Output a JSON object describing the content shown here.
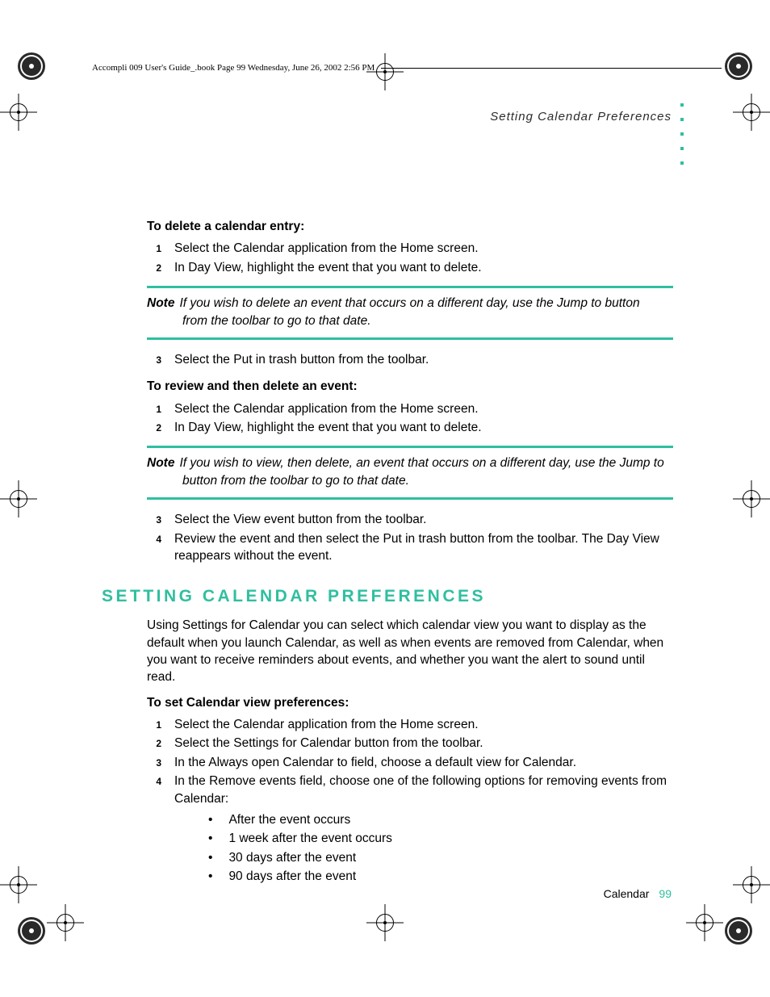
{
  "book_header": "Accompli 009 User's Guide_.book  Page 99  Wednesday, June 26, 2002  2:56 PM",
  "running_head": "Setting Calendar Preferences",
  "sections": {
    "delete": {
      "heading": "To delete a calendar entry:",
      "step1": "Select the Calendar application from the Home screen.",
      "step2": "In Day View, highlight the event that you want to delete.",
      "note_label": "Note",
      "note_text_1": "If you wish to delete an event that occurs on a different day, use the Jump to button",
      "note_text_2": "from the toolbar to go to that date.",
      "step3": "Select the Put in trash button from the toolbar."
    },
    "review_delete": {
      "heading": "To review and then delete an event:",
      "step1": "Select the Calendar application from the Home screen.",
      "step2": "In Day View, highlight the event that you want to delete.",
      "note_label": "Note",
      "note_text_1": "If you wish to view, then delete, an event that occurs on a different day, use the Jump to",
      "note_text_2": "button from the toolbar to go to that date.",
      "step3": "Select the View event button from the toolbar.",
      "step4": "Review the event and then select the Put in trash button from the toolbar. The Day View reappears without the event."
    },
    "prefs": {
      "title": "SETTING CALENDAR PREFERENCES",
      "intro": "Using Settings for Calendar you can select which calendar view you want to display as the default when you launch Calendar, as well as when events are removed from Calendar, when you want to receive reminders about events, and whether you want the alert to sound until read.",
      "heading": "To set Calendar view preferences:",
      "step1": "Select the Calendar application from the Home screen.",
      "step2": "Select the Settings for Calendar button from the toolbar.",
      "step3": "In the Always open Calendar to field, choose a default view for Calendar.",
      "step4": "In the Remove events field, choose one of the following options for removing events from Calendar:",
      "bullets": {
        "b1": "After the event occurs",
        "b2": "1 week after the event occurs",
        "b3": "30 days after the event",
        "b4": "90 days after the event"
      }
    }
  },
  "footer": {
    "chapter": "Calendar",
    "page": "99"
  },
  "nums": {
    "n1": "1",
    "n2": "2",
    "n3": "3",
    "n4": "4"
  },
  "bullet": "•"
}
